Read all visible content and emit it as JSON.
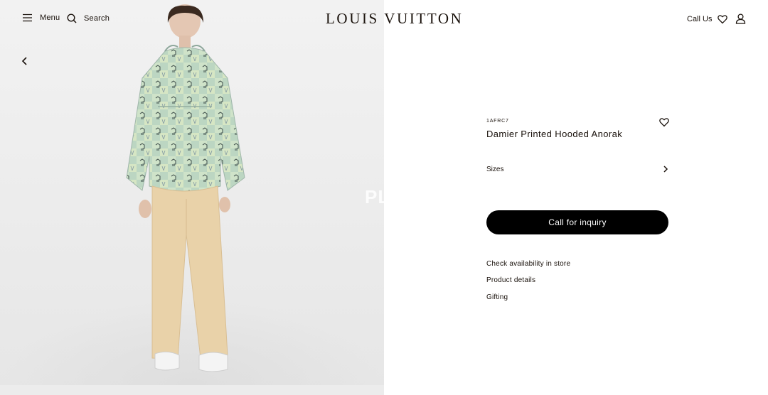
{
  "header": {
    "menu_label": "Menu",
    "search_label": "Search",
    "brand": "LOUIS VUITTON",
    "call_us_label": "Call Us",
    "icons": [
      "hamburger-menu-icon",
      "search-icon",
      "heart-icon",
      "account-icon"
    ]
  },
  "gallery": {
    "overlay_text": "PL",
    "prev_icon": "chevron-left-icon"
  },
  "product": {
    "sku": "1AFRC7",
    "title": "Damier Printed Hooded Anorak",
    "sizes_label": "Sizes",
    "cta_label": "Call for inquiry",
    "links": {
      "availability": "Check availability in store",
      "details": "Product details",
      "gifting": "Gifting"
    }
  },
  "colors": {
    "text": "#19110b",
    "cta_background": "#000000",
    "cta_text": "#ffffff",
    "gallery_background": "#eeeeee"
  }
}
